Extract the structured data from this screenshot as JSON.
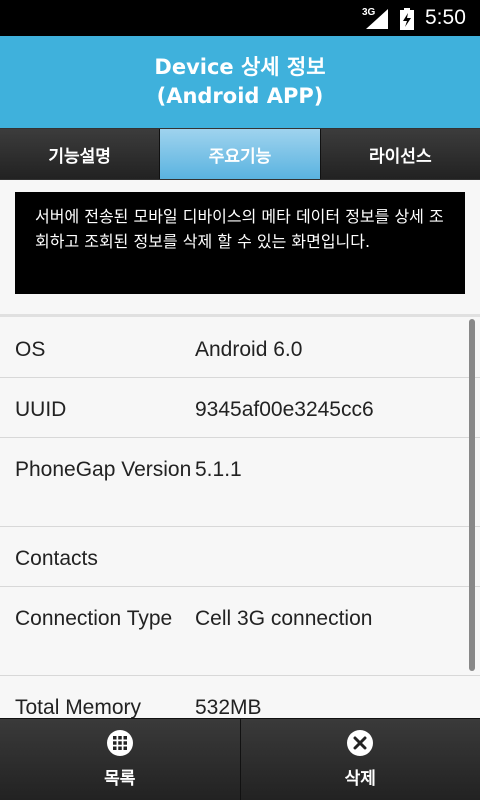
{
  "status_bar": {
    "network": "3G",
    "time": "5:50",
    "signal_icon": "signal-icon",
    "battery_icon": "battery-charging-icon"
  },
  "header": {
    "title_line1": "Device 상세 정보",
    "title_line2": "(Android APP)"
  },
  "tabs": [
    {
      "label": "기능설명",
      "active": false
    },
    {
      "label": "주요기능",
      "active": true
    },
    {
      "label": "라이선스",
      "active": false
    }
  ],
  "notice": {
    "text": "서버에 전송된 모바일 디바이스의 메타 데이터 정보를 상세 조회하고 조회된 정보를 삭제 할 수 있는 화면입니다."
  },
  "info_rows": [
    {
      "label": "OS",
      "value": "Android 6.0"
    },
    {
      "label": "UUID",
      "value": "9345af00e3245cc6"
    },
    {
      "label": "PhoneGap Version",
      "value": "5.1.1"
    },
    {
      "label": "Contacts",
      "value": ""
    },
    {
      "label": "Connection Type",
      "value": "Cell 3G connection"
    },
    {
      "label": "Total Memory",
      "value": "532MB"
    }
  ],
  "footer": {
    "list_label": "목록",
    "list_icon": "grid-icon",
    "delete_label": "삭제",
    "delete_icon": "close-icon"
  },
  "colors": {
    "header_bg": "#3fb1dc",
    "active_tab": "#5ab3e0"
  }
}
